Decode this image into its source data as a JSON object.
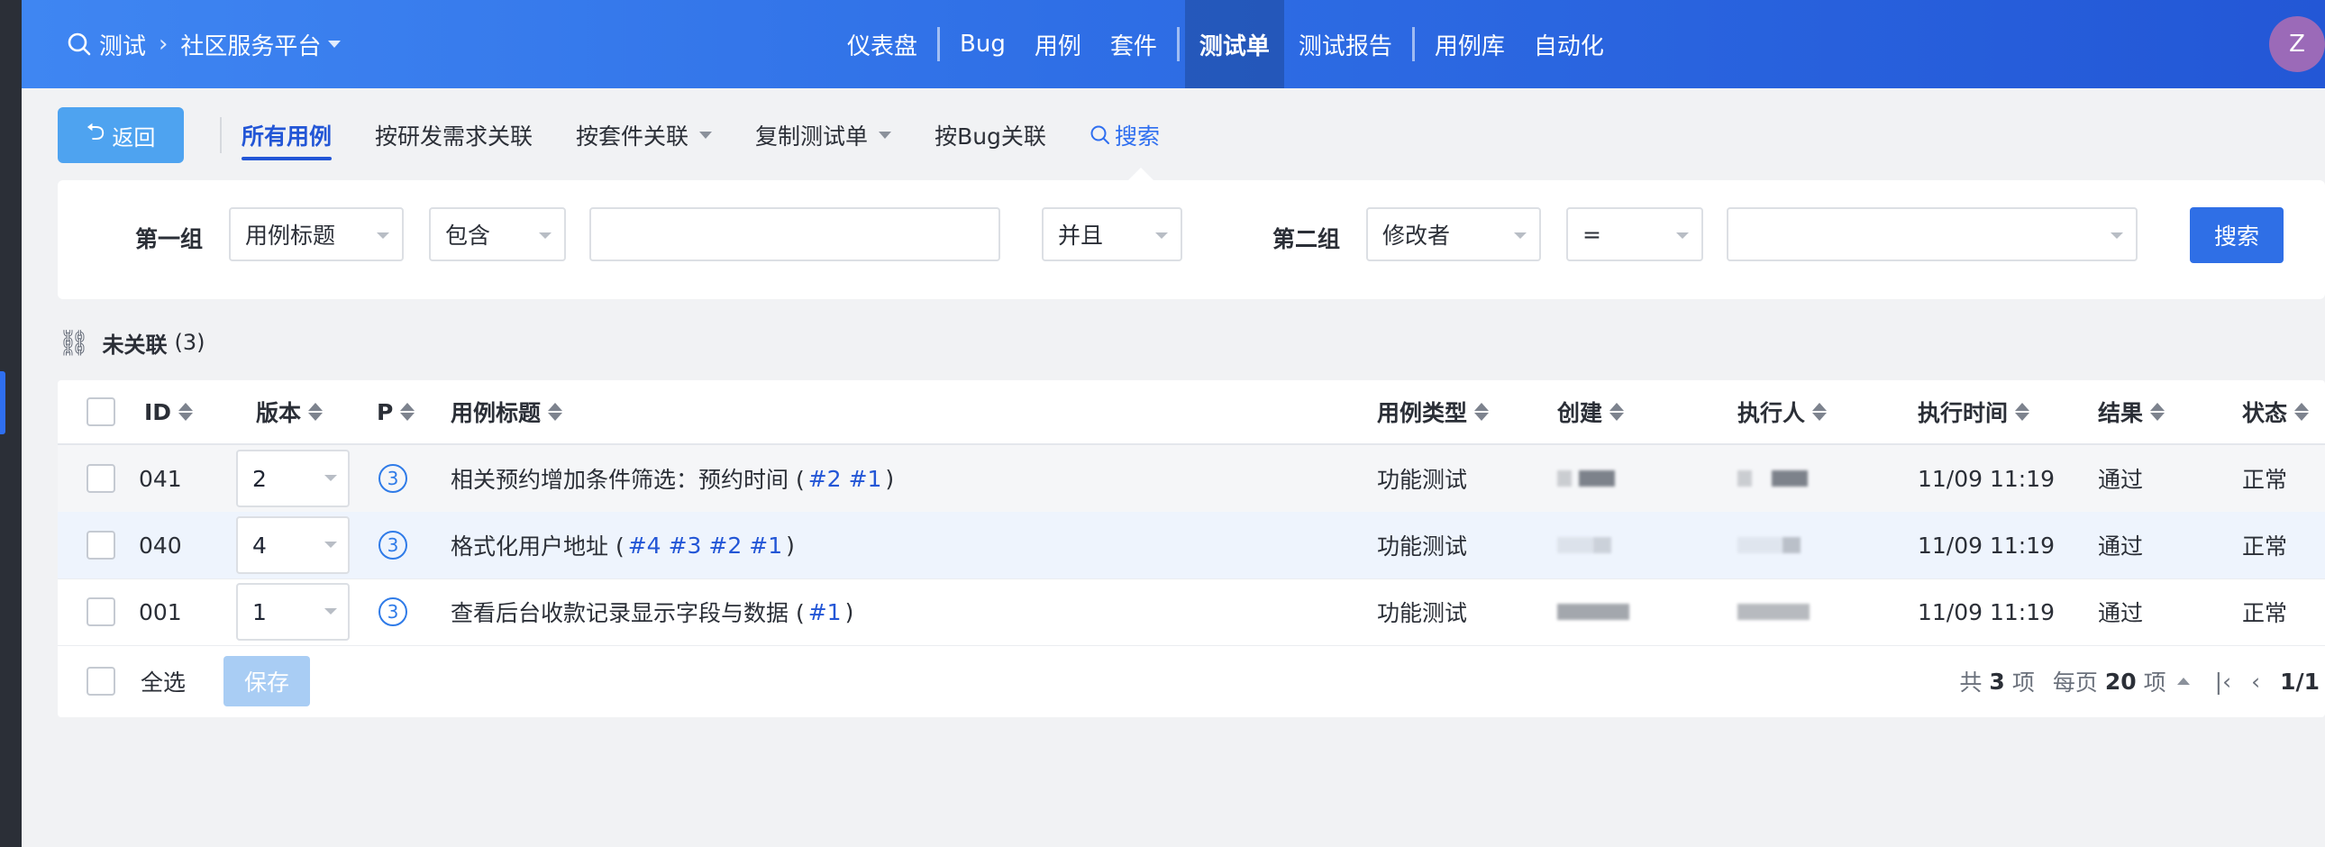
{
  "header": {
    "product": "测试",
    "project": "社区服务平台",
    "nav": [
      "仪表盘",
      "Bug",
      "用例",
      "套件",
      "测试单",
      "测试报告",
      "用例库",
      "自动化"
    ],
    "active_nav": "测试单",
    "avatar_letter": "Z"
  },
  "subnav": {
    "back_label": "返回",
    "tabs": [
      "所有用例",
      "按研发需求关联",
      "按套件关联",
      "复制测试单",
      "按Bug关联"
    ],
    "search_label": "搜索"
  },
  "search": {
    "group1_label": "第一组",
    "group1_field": "用例标题",
    "group1_operator": "包含",
    "group1_value": "",
    "andor": "并且",
    "group2_label": "第二组",
    "group2_field": "修改者",
    "group2_operator": "=",
    "group2_value": "",
    "button_label": "搜索"
  },
  "group": {
    "title": "未关联",
    "count": "(3)"
  },
  "table": {
    "headers": {
      "id": "ID",
      "version": "版本",
      "pri": "P",
      "title": "用例标题",
      "type": "用例类型",
      "creator": "创建",
      "executor": "执行人",
      "exec_time": "执行时间",
      "result": "结果",
      "status": "状态"
    },
    "rows": [
      {
        "id": "041",
        "version": "2",
        "pri": "3",
        "title": "相关预约增加条件筛选：预约时间 (",
        "links": [
          "#2",
          "#1"
        ],
        "close": ")",
        "type": "功能测试",
        "exec_time": "11/09 11:19",
        "result": "通过",
        "status": "正常"
      },
      {
        "id": "040",
        "version": "4",
        "pri": "3",
        "title": "格式化用户地址 (",
        "links": [
          "#4",
          "#3",
          "#2",
          "#1"
        ],
        "close": ")",
        "type": "功能测试",
        "exec_time": "11/09 11:19",
        "result": "通过",
        "status": "正常"
      },
      {
        "id": "001",
        "version": "1",
        "pri": "3",
        "title": "查看后台收款记录显示字段与数据 (",
        "links": [
          "#1"
        ],
        "close": ")",
        "type": "功能测试",
        "exec_time": "11/09 11:19",
        "result": "通过",
        "status": "正常"
      }
    ]
  },
  "footer": {
    "select_all": "全选",
    "save_label": "保存",
    "total_prefix": "共",
    "total": "3",
    "total_suffix": "项",
    "per_page_prefix": "每页",
    "per_page": "20",
    "per_page_suffix": "项",
    "page": "1/1"
  }
}
